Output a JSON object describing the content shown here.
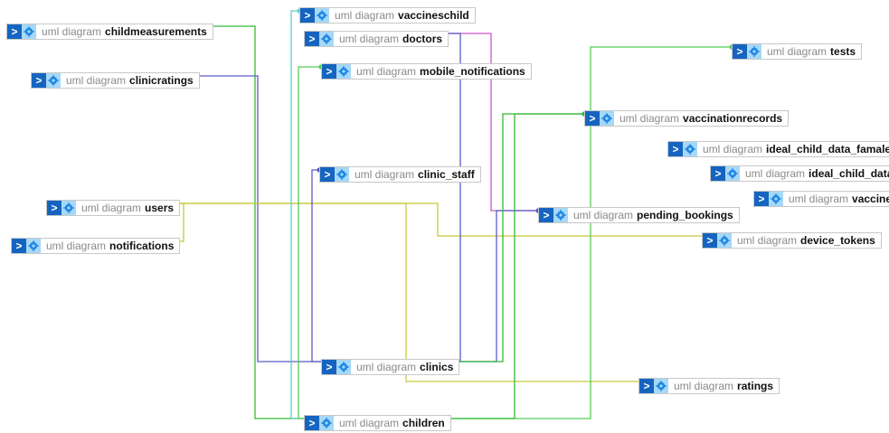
{
  "diagram": {
    "prefix": "uml diagram",
    "nodes": [
      {
        "id": "childmeasurements",
        "label": "childmeasurements"
      },
      {
        "id": "clinicratings",
        "label": "clinicratings"
      },
      {
        "id": "users",
        "label": "users"
      },
      {
        "id": "notifications",
        "label": "notifications"
      },
      {
        "id": "vaccineschild",
        "label": "vaccineschild"
      },
      {
        "id": "doctors",
        "label": "doctors"
      },
      {
        "id": "mobile_notifications",
        "label": "mobile_notifications"
      },
      {
        "id": "clinic_staff",
        "label": "clinic_staff"
      },
      {
        "id": "clinics",
        "label": "clinics"
      },
      {
        "id": "children",
        "label": "children"
      },
      {
        "id": "tests",
        "label": "tests"
      },
      {
        "id": "vaccinationrecords",
        "label": "vaccinationrecords"
      },
      {
        "id": "ideal_child_data_famale",
        "label": "ideal_child_data_famale"
      },
      {
        "id": "ideal_child_data",
        "label": "ideal_child_data"
      },
      {
        "id": "vaccines",
        "label": "vaccines"
      },
      {
        "id": "pending_bookings",
        "label": "pending_bookings"
      },
      {
        "id": "device_tokens",
        "label": "device_tokens"
      },
      {
        "id": "ratings",
        "label": "ratings"
      }
    ],
    "links": [
      {
        "from": "childmeasurements",
        "to": "children",
        "color": "#33bb33"
      },
      {
        "from": "clinicratings",
        "to": "clinics",
        "color": "#5a5ac8"
      },
      {
        "from": "users",
        "to": "notifications",
        "color": "#c8c83c"
      },
      {
        "from": "users",
        "to": "device_tokens",
        "color": "#c8c83c"
      },
      {
        "from": "users",
        "to": "ratings",
        "color": "#c8c83c"
      },
      {
        "from": "vaccineschild",
        "to": "children",
        "color": "#5ccfc0"
      },
      {
        "from": "mobile_notifications",
        "to": "children",
        "color": "#55cc55"
      },
      {
        "from": "doctors",
        "to": "pending_bookings",
        "color": "#cc55cc"
      },
      {
        "from": "doctors",
        "to": "clinics",
        "color": "#5a5ac8"
      },
      {
        "from": "clinic_staff",
        "to": "clinics",
        "color": "#5a5ac8"
      },
      {
        "from": "pending_bookings",
        "to": "clinics",
        "color": "#5a5ac8"
      },
      {
        "from": "vaccinationrecords",
        "to": "clinics",
        "color": "#33bb33"
      },
      {
        "from": "tests",
        "to": "children",
        "color": "#55cc55"
      },
      {
        "from": "vaccinationrecords",
        "to": "children",
        "color": "#33bb33"
      }
    ]
  }
}
